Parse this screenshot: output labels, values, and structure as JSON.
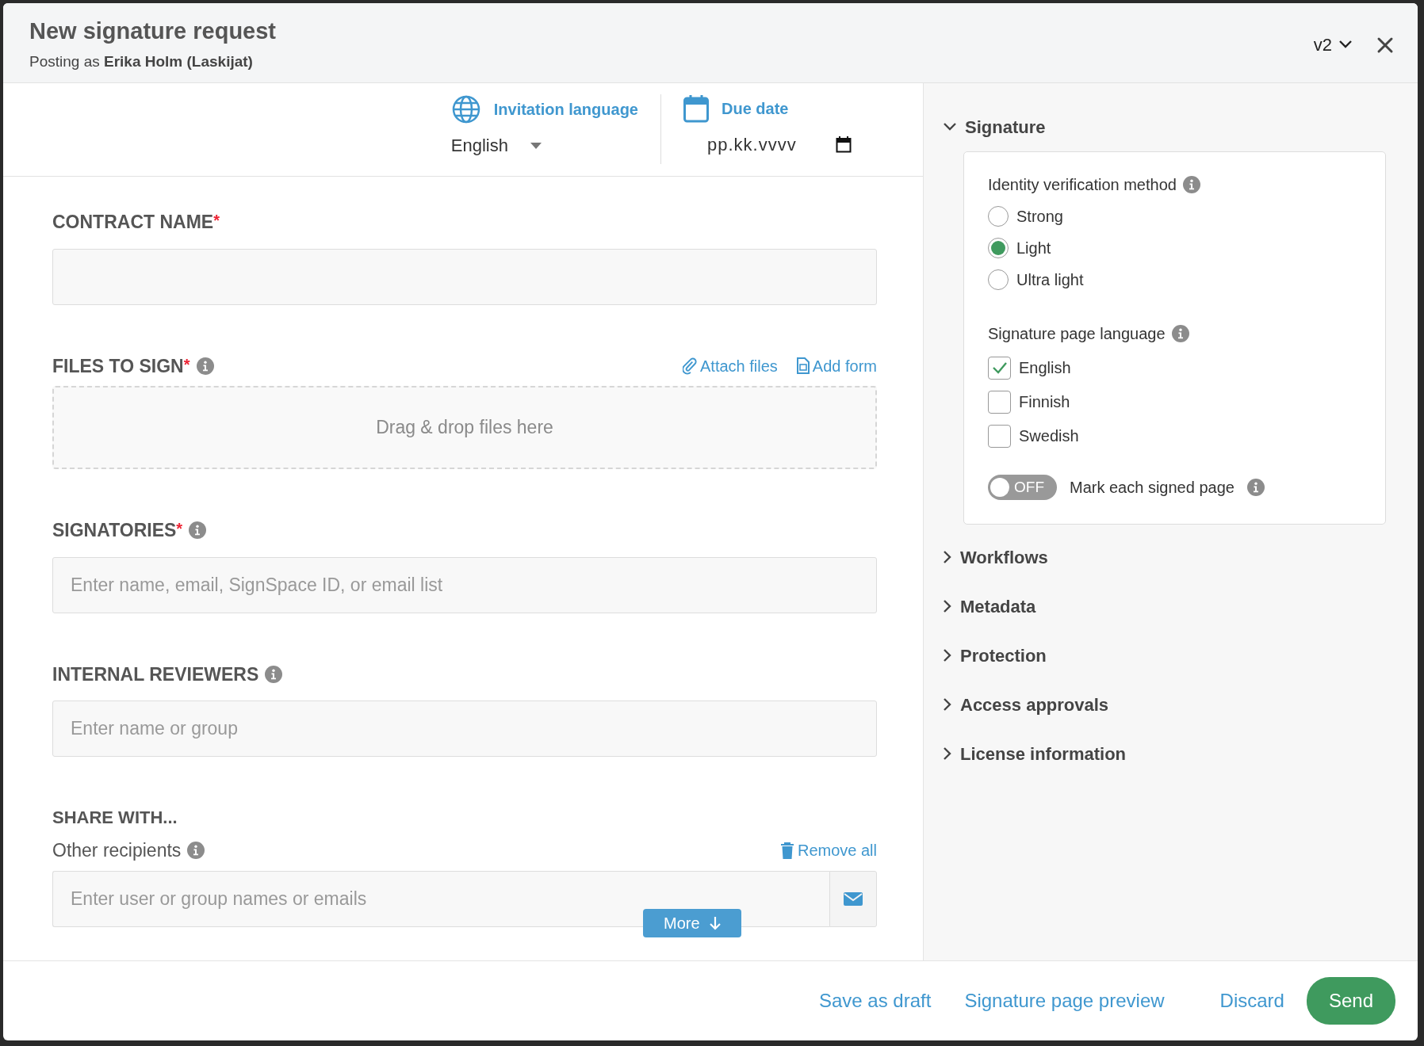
{
  "dialog": {
    "title": "New signature request",
    "subtitle": "Posting as **Erika Holm (Laskijat)**",
    "version": "v2"
  },
  "invitation_language": {
    "label": "Invitation language",
    "value": "English"
  },
  "due_date": {
    "label": "Due date",
    "placeholder": "pp.kk.vvvv"
  },
  "fields": [
    {
      "kind": "text",
      "label": "CONTRACT NAME",
      "required_mark": "*",
      "info": false
    },
    {
      "kind": "files",
      "label": "FILES TO SIGN",
      "required_mark": "*",
      "info": true,
      "actions": [
        {
          "kind": "attach",
          "label": "Attach files"
        },
        {
          "kind": "form",
          "label": "Add form"
        }
      ],
      "dropzone": "Drag & drop files here"
    },
    {
      "kind": "text",
      "label": "SIGNATORIES",
      "required_mark": "*",
      "info": true,
      "placeholder": "Enter name, email, SignSpace ID, or email list"
    },
    {
      "kind": "text",
      "label": "INTERNAL REVIEWERS",
      "info": true,
      "placeholder": "Enter name or group"
    }
  ],
  "share": {
    "title": "SHARE WITH...",
    "label": "Other recipients",
    "info": true,
    "remove_all": "Remove all",
    "placeholder": "Enter user or group names or emails",
    "more": "More"
  },
  "sidebar": {
    "sections": [
      {
        "title": "Signature",
        "expanded": true
      },
      {
        "title": "Workflows",
        "expanded": false
      },
      {
        "title": "Metadata",
        "expanded": false
      },
      {
        "title": "Protection",
        "expanded": false
      },
      {
        "title": "Access approvals",
        "expanded": false
      },
      {
        "title": "License information",
        "expanded": false
      }
    ]
  },
  "signature": {
    "verification": {
      "label": "Identity verification method",
      "options": [
        {
          "label": "Strong",
          "selected": false
        },
        {
          "label": "Light",
          "selected": true
        },
        {
          "label": "Ultra light",
          "selected": false
        }
      ]
    },
    "languages": {
      "label": "Signature page language",
      "options": [
        {
          "label": "English",
          "checked": true
        },
        {
          "label": "Finnish",
          "checked": false
        },
        {
          "label": "Swedish",
          "checked": false
        }
      ]
    },
    "mark_pages": {
      "on": false,
      "state_label": "OFF",
      "label": "Mark each signed page"
    }
  },
  "footer": {
    "buttons": [
      {
        "kind": "link",
        "label": "Save as draft"
      },
      {
        "kind": "link",
        "label": "Signature page preview"
      },
      {
        "kind": "link",
        "label": "Discard"
      },
      {
        "kind": "primary",
        "label": "Send"
      }
    ]
  }
}
